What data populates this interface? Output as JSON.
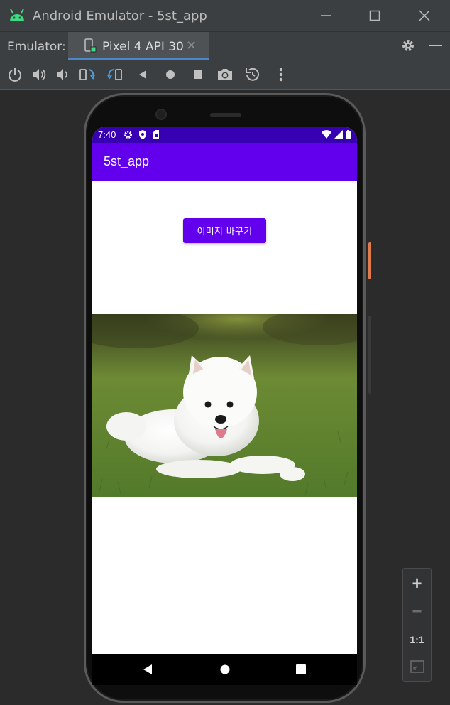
{
  "window": {
    "title": "Android Emulator - 5st_app",
    "icon": "android-robot-icon",
    "accent": "#3ddc84"
  },
  "tabbar": {
    "label": "Emulator:",
    "tab_label": "Pixel 4 API 30",
    "tab_close": "✕",
    "tab_accent": "#4a88c7"
  },
  "toolbar": {
    "icons": [
      "power-icon",
      "volume-up-icon",
      "volume-down-icon",
      "rotate-left-icon",
      "rotate-right-icon",
      "back-icon",
      "home-icon",
      "overview-icon",
      "screenshot-icon",
      "snapshot-icon",
      "more-icon"
    ]
  },
  "device": {
    "status_time": "7:40",
    "status_left_icons": [
      "settings-icon",
      "shield-icon",
      "sim-icon"
    ],
    "status_right_icons": [
      "wifi-icon",
      "signal-icon",
      "battery-icon"
    ],
    "statusbar_color": "#3700b3",
    "app_title": "5st_app",
    "appbar_color": "#6200ee",
    "button_label": "이미지 바꾸기",
    "image": "samoyed-puppy-on-grass",
    "nav_icons": [
      "nav-back-icon",
      "nav-home-icon",
      "nav-recents-icon"
    ]
  },
  "zoom": {
    "zoom_in": "+",
    "zoom_out": "−",
    "actual_size": "1:1",
    "fit_icon": "fit-screen-icon"
  }
}
